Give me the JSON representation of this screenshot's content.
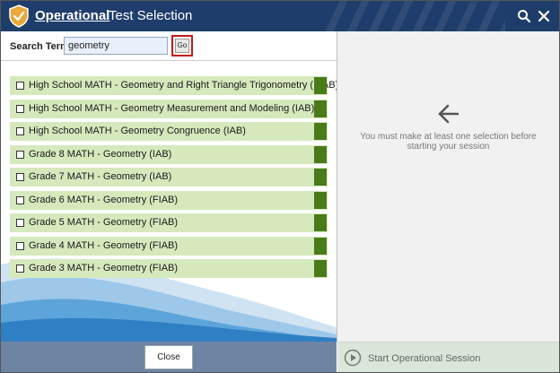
{
  "header": {
    "title_bold": "Operational",
    "title_rest": "Test Selection",
    "search_icon": "search-icon",
    "close_icon": "close-icon"
  },
  "search": {
    "label": "Search Term:",
    "value": "geometry",
    "go_label": "Go"
  },
  "tests": [
    {
      "label": "High School MATH - Geometry and Right Triangle Trigonometry (FIAB)"
    },
    {
      "label": "High School MATH - Geometry Measurement and Modeling (IAB)"
    },
    {
      "label": "High School MATH - Geometry Congruence (IAB)"
    },
    {
      "label": "Grade 8 MATH - Geometry (IAB)"
    },
    {
      "label": "Grade 7 MATH - Geometry (IAB)"
    },
    {
      "label": "Grade 6 MATH - Geometry (FIAB)"
    },
    {
      "label": "Grade 5 MATH - Geometry (FIAB)"
    },
    {
      "label": "Grade 4 MATH - Geometry (FIAB)"
    },
    {
      "label": "Grade 3 MATH - Geometry (FIAB)"
    }
  ],
  "right_panel": {
    "message": "You must make at least one selection before starting your session",
    "arrow_icon": "arrow-left-icon"
  },
  "footer": {
    "close_label": "Close",
    "start_label": "Start Operational Session",
    "start_icon": "play-circle-icon"
  },
  "colors": {
    "titlebar": "#1f3d6b",
    "row_bg": "#d5e9bd",
    "row_tag": "#4a7a1a",
    "highlight": "#c41a1a"
  }
}
